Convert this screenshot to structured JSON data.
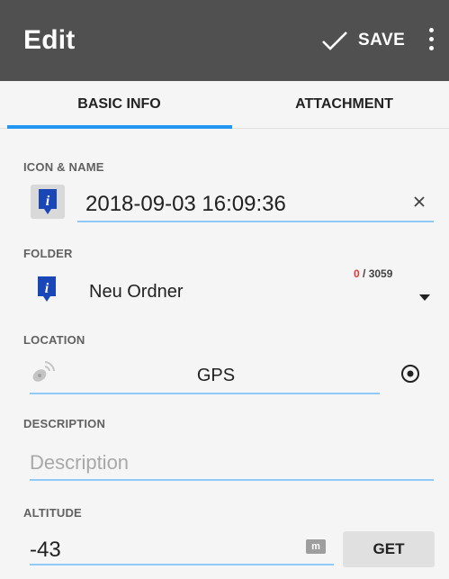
{
  "app_bar": {
    "title": "Edit",
    "save_label": "SAVE"
  },
  "tabs": [
    {
      "label": "BASIC INFO",
      "active": true
    },
    {
      "label": "ATTACHMENT",
      "active": false
    }
  ],
  "icon_name": {
    "label": "ICON & NAME",
    "value": "2018-09-03 16:09:36",
    "clear_symbol": "×"
  },
  "folder": {
    "label": "FOLDER",
    "name": "Neu Ordner",
    "count_used": "0",
    "count_total": " / 3059"
  },
  "location": {
    "label": "LOCATION",
    "source": "GPS"
  },
  "description": {
    "label": "DESCRIPTION",
    "placeholder": "Description",
    "value": ""
  },
  "altitude": {
    "label": "ALTITUDE",
    "value": "-43",
    "unit": "m",
    "get_label": "GET"
  },
  "colors": {
    "app_bar": "#505050",
    "accent": "#2196f3",
    "field_underline": "#90caf9",
    "icon_blue": "#1a47b8",
    "count_red": "#e53935"
  }
}
